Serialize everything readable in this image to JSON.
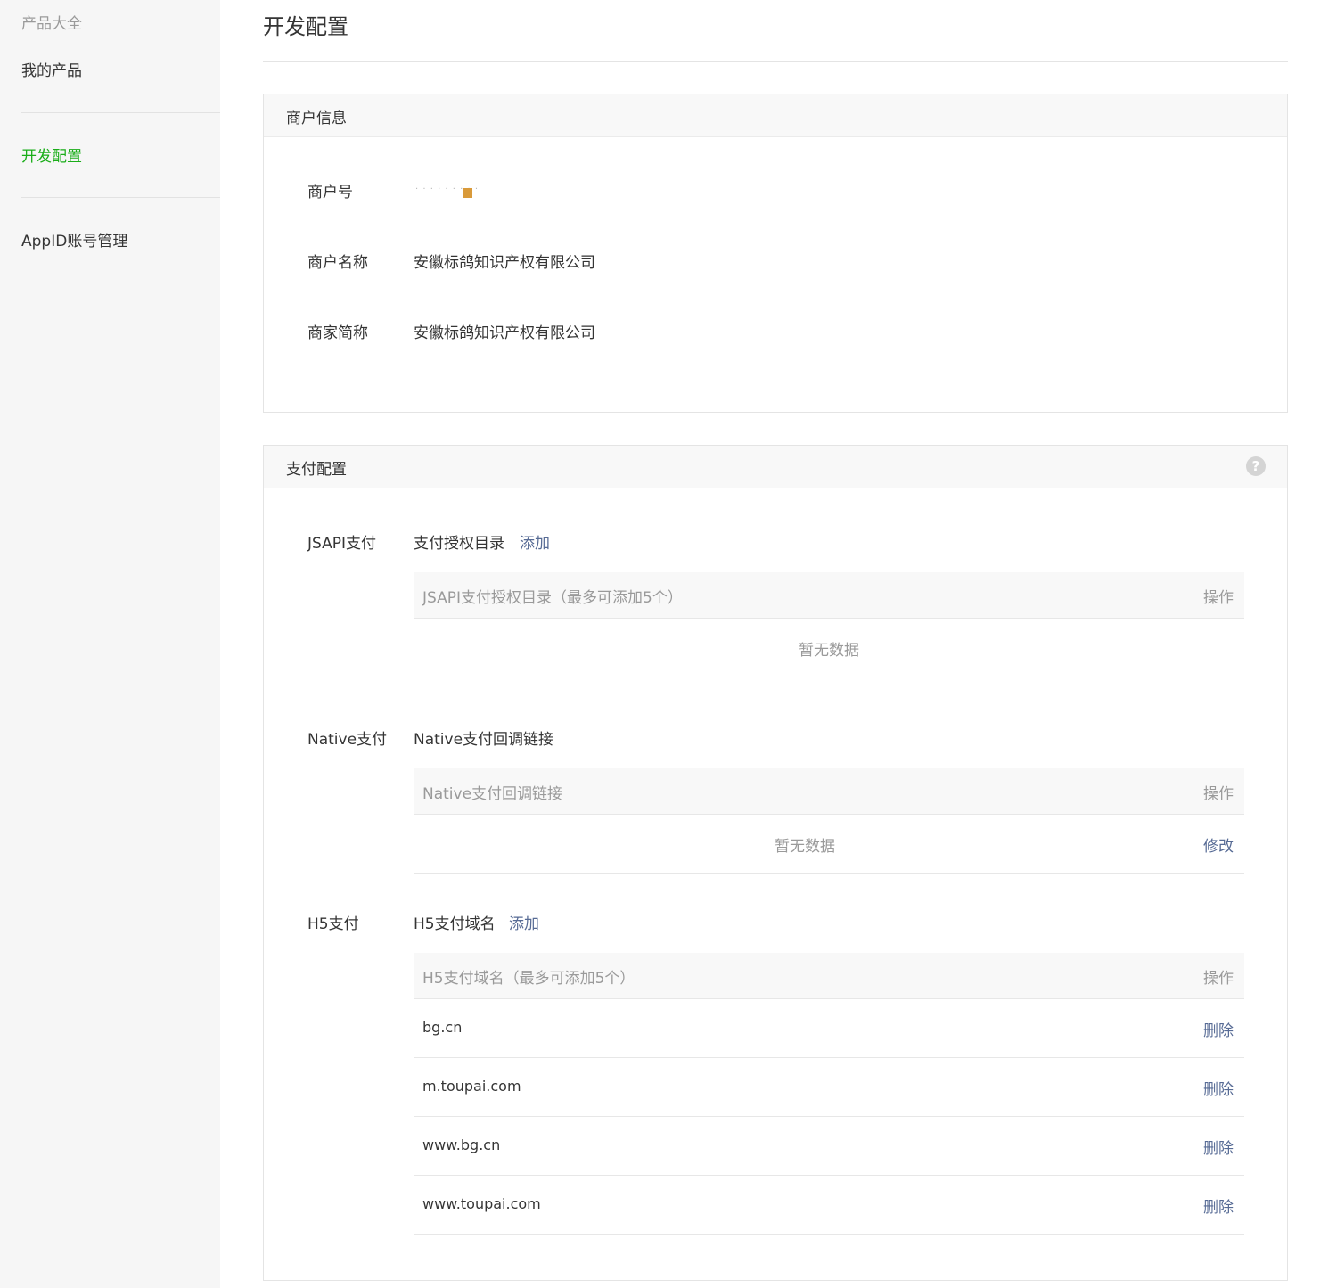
{
  "sidebar": {
    "group_title": "产品大全",
    "items": [
      {
        "label": "我的产品"
      },
      {
        "label": "开发配置"
      },
      {
        "label": "AppID账号管理"
      }
    ]
  },
  "page": {
    "title": "开发配置"
  },
  "merchant_info": {
    "header": "商户信息",
    "merchant_id_label": "商户号",
    "merchant_name_label": "商户名称",
    "merchant_name": "安徽标鸽知识产权有限公司",
    "short_name_label": "商家简称",
    "short_name": "安徽标鸽知识产权有限公司"
  },
  "payment_config": {
    "header": "支付配置",
    "help_glyph": "?",
    "jsapi": {
      "label": "JSAPI支付",
      "sub_title": "支付授权目录",
      "add_label": "添加",
      "col_main": "JSAPI支付授权目录（最多可添加5个）",
      "col_action": "操作",
      "empty_text": "暂无数据"
    },
    "native": {
      "label": "Native支付",
      "sub_title": "Native支付回调链接",
      "col_main": "Native支付回调链接",
      "col_action": "操作",
      "empty_text": "暂无数据",
      "edit_label": "修改"
    },
    "h5": {
      "label": "H5支付",
      "sub_title": "H5支付域名",
      "add_label": "添加",
      "col_main": "H5支付域名（最多可添加5个）",
      "col_action": "操作",
      "rows": [
        {
          "domain": "bg.cn",
          "action": "删除"
        },
        {
          "domain": "m.toupai.com",
          "action": "删除"
        },
        {
          "domain": "www.bg.cn",
          "action": "删除"
        },
        {
          "domain": "www.toupai.com",
          "action": "删除"
        }
      ]
    }
  },
  "colors": {
    "active_green": "#1aad19",
    "link_blue": "#576b95",
    "muted_gray": "#9a9a9a"
  }
}
